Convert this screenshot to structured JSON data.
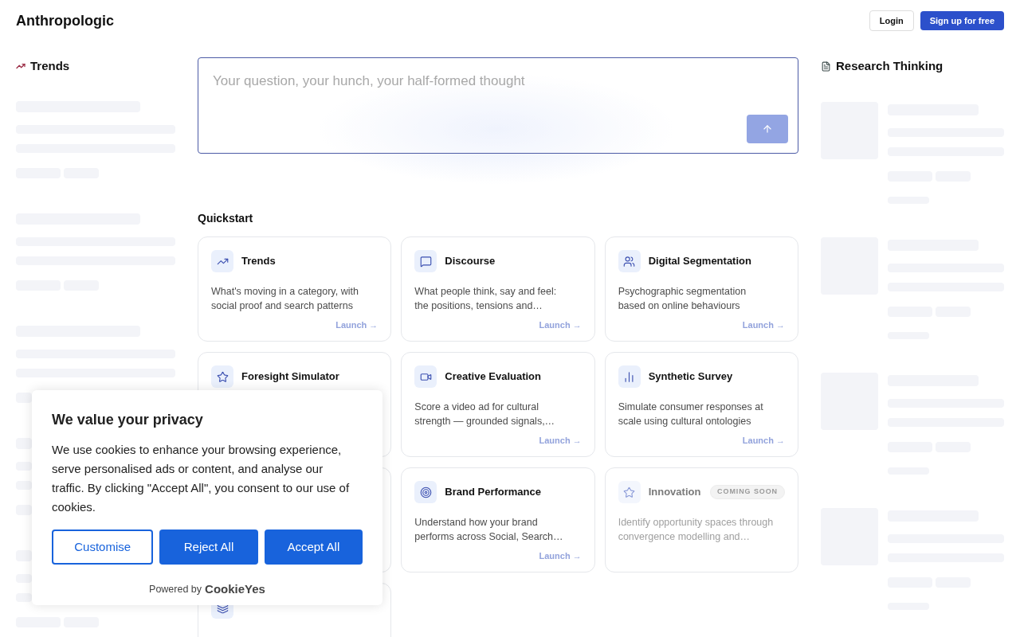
{
  "header": {
    "logo": "Anthropologic",
    "login": "Login",
    "signup": "Sign up for free"
  },
  "trends": {
    "title": "Trends"
  },
  "prompt": {
    "placeholder": "Your question, your hunch, your half-formed thought"
  },
  "quickstart": {
    "title": "Quickstart",
    "cards": [
      {
        "kind": "tool",
        "title": "Trends",
        "description": "What's moving in a category, with social proof and search patterns",
        "launch": "Launch →",
        "disabled": false
      },
      {
        "kind": "tool",
        "title": "Discourse",
        "description": "What people think, say and feel: the positions, tensions and…",
        "launch": "Launch →",
        "disabled": false
      },
      {
        "kind": "tool",
        "title": "Digital Segmentation",
        "description": "Psychographic segmentation based on online behaviours",
        "launch": "Launch →",
        "disabled": false
      },
      {
        "kind": "tool",
        "title": "Foresight Simulator",
        "disabled": false
      },
      {
        "kind": "tool",
        "title": "Creative Evaluation",
        "description": "Score a video ad for cultural strength — grounded signals,…",
        "launch": "Launch →",
        "disabled": false
      },
      {
        "kind": "tool",
        "title": "Synthetic Survey",
        "description": "Simulate consumer responses at scale using cultural ontologies",
        "launch": "Launch →",
        "disabled": false
      },
      {
        "kind": "hidden"
      },
      {
        "kind": "tool",
        "title": "Brand Performance",
        "description": "Understand how your brand performs across Social, Search…",
        "launch": "Launch →",
        "disabled": false
      },
      {
        "kind": "tool",
        "title": "Innovation",
        "badge": "COMING SOON",
        "description": "Identify opportunity spaces through convergence modelling and…",
        "disabled": true
      },
      {
        "kind": "covered"
      }
    ]
  },
  "research": {
    "title": "Research Thinking"
  },
  "cookie_banner": {
    "title": "We value your privacy",
    "body": "We use cookies to enhance your browsing experience, serve personalised ads or content, and analyse our traffic. By clicking \"Accept All\", you consent to our use of cookies.",
    "buttons": [
      {
        "label": "Customise",
        "kind": "outline"
      },
      {
        "label": "Reject All",
        "kind": "solid"
      },
      {
        "label": "Accept All",
        "kind": "solid"
      }
    ],
    "powered_by": "Powered by",
    "brand": "CookieYes"
  }
}
